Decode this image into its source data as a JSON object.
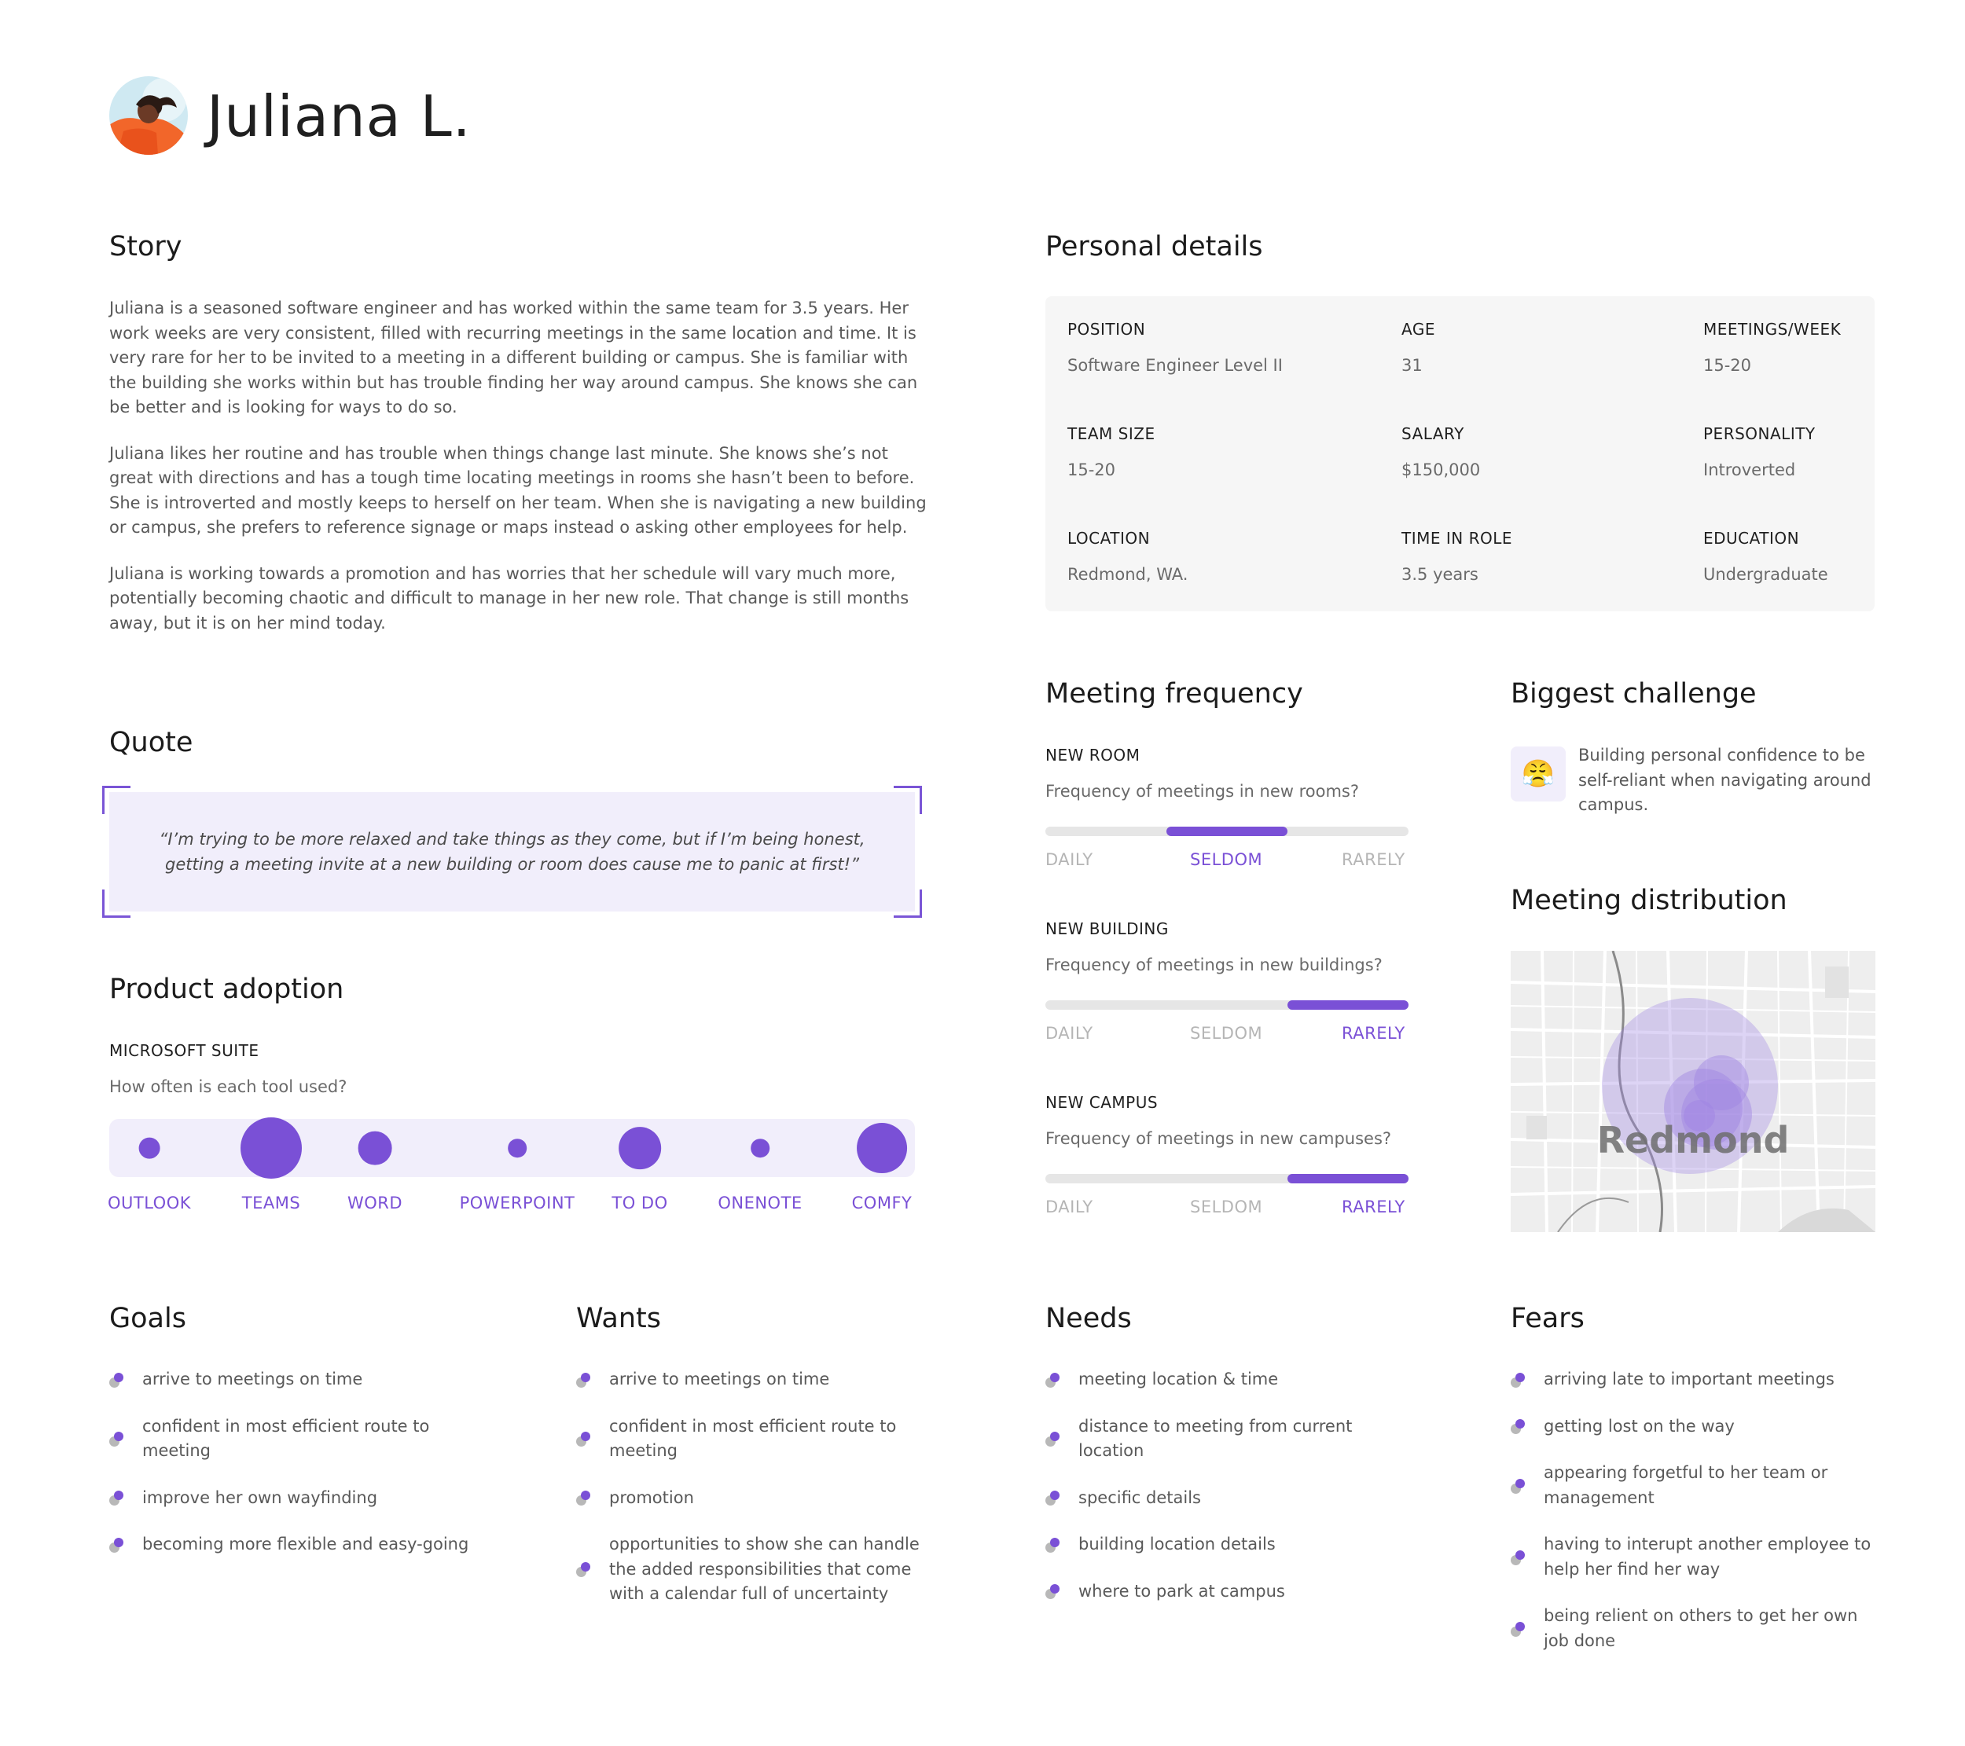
{
  "header": {
    "name": "Juliana L."
  },
  "story": {
    "title": "Story",
    "paragraphs": [
      "Juliana is a seasoned software engineer and has worked within the same team for 3.5 years. Her work weeks are very consistent, filled with recurring meetings in the same location and time. It is very rare for her to be invited to a meeting in a different building or campus. She is familiar with the building she works within but has trouble finding her way around campus. She knows she can be better and is looking for ways to do so.",
      "Juliana likes her routine and has trouble when things change last minute. She knows she’s not great with directions and has a tough time locating meetings in rooms she hasn’t been to before. She is introverted and mostly keeps to herself on her team. When she is navigating a new building or campus, she prefers to reference signage or maps instead o asking other employees for help.",
      "Juliana is working towards a promotion and has worries that her schedule will vary much more, potentially becoming chaotic and difficult to manage in her new role. That change is still months away, but it is on her mind today."
    ]
  },
  "quote": {
    "title": "Quote",
    "text": "“I’m trying to be more relaxed and take things as they come, but if I’m being honest, getting a meeting invite at a new building or room does cause me to panic at first!”"
  },
  "product_adoption": {
    "title": "Product adoption",
    "suite": "MICROSOFT SUITE",
    "question": "How often is each tool used?",
    "tools": [
      {
        "label": "OUTLOOK",
        "level": 0.2
      },
      {
        "label": "TEAMS",
        "level": 1.0
      },
      {
        "label": "WORD",
        "level": 0.45
      },
      {
        "label": "POWERPOINT",
        "level": 0.15
      },
      {
        "label": "TO DO",
        "level": 0.62
      },
      {
        "label": "ONENOTE",
        "level": 0.15
      },
      {
        "label": "COMFY",
        "level": 0.78
      }
    ]
  },
  "personal_details": {
    "title": "Personal details",
    "fields": [
      {
        "label": "POSITION",
        "value": "Software Engineer Level II"
      },
      {
        "label": "AGE",
        "value": "31"
      },
      {
        "label": "MEETINGS/WEEK",
        "value": "15-20"
      },
      {
        "label": "TEAM SIZE",
        "value": "15-20"
      },
      {
        "label": "SALARY",
        "value": "$150,000"
      },
      {
        "label": "PERSONALITY",
        "value": "Introverted"
      },
      {
        "label": "LOCATION",
        "value": "Redmond, WA."
      },
      {
        "label": "TIME IN ROLE",
        "value": "3.5 years"
      },
      {
        "label": "EDUCATION",
        "value": "Undergraduate"
      }
    ]
  },
  "meeting_frequency": {
    "title": "Meeting frequency",
    "options": [
      "DAILY",
      "SELDOM",
      "RARELY"
    ],
    "items": [
      {
        "label": "NEW ROOM",
        "question": "Frequency of meetings in new rooms?",
        "selected": "SELDOM",
        "selected_index": 1
      },
      {
        "label": "NEW BUILDING",
        "question": "Frequency of meetings in new buildings?",
        "selected": "RARELY",
        "selected_index": 2
      },
      {
        "label": "NEW CAMPUS",
        "question": "Frequency of meetings in new campuses?",
        "selected": "RARELY",
        "selected_index": 2
      }
    ]
  },
  "challenge": {
    "title": "Biggest challenge",
    "emoji": "😤",
    "text": "Building personal confidence to be self-reliant when navigating around campus."
  },
  "distribution": {
    "title": "Meeting distribution",
    "map_label": "Redmond"
  },
  "goals": {
    "title": "Goals",
    "items": [
      "arrive to meetings on time",
      "confident in most efficient route to meeting",
      "improve her own wayfinding",
      "becoming more flexible and easy-going"
    ]
  },
  "wants": {
    "title": "Wants",
    "items": [
      "arrive to meetings on time",
      "confident in most efficient route to meeting",
      "promotion",
      "opportunities to show she can handle the added responsibilities that come with a calendar full of uncertainty"
    ]
  },
  "needs": {
    "title": "Needs",
    "items": [
      "meeting location & time",
      "distance to meeting from current location",
      "specific details",
      "building location details",
      "where to park at campus"
    ]
  },
  "fears": {
    "title": "Fears",
    "items": [
      "arriving late to important meetings",
      "getting lost on the way",
      "appearing forgetful to her team or management",
      "having to interupt another employee to help her find her way",
      "being relient on others to get her own job done"
    ]
  },
  "colors": {
    "accent": "#7a50d6",
    "accent_light": "#f1eefb",
    "panel": "#f6f6f6",
    "track": "#e6e6e6"
  }
}
